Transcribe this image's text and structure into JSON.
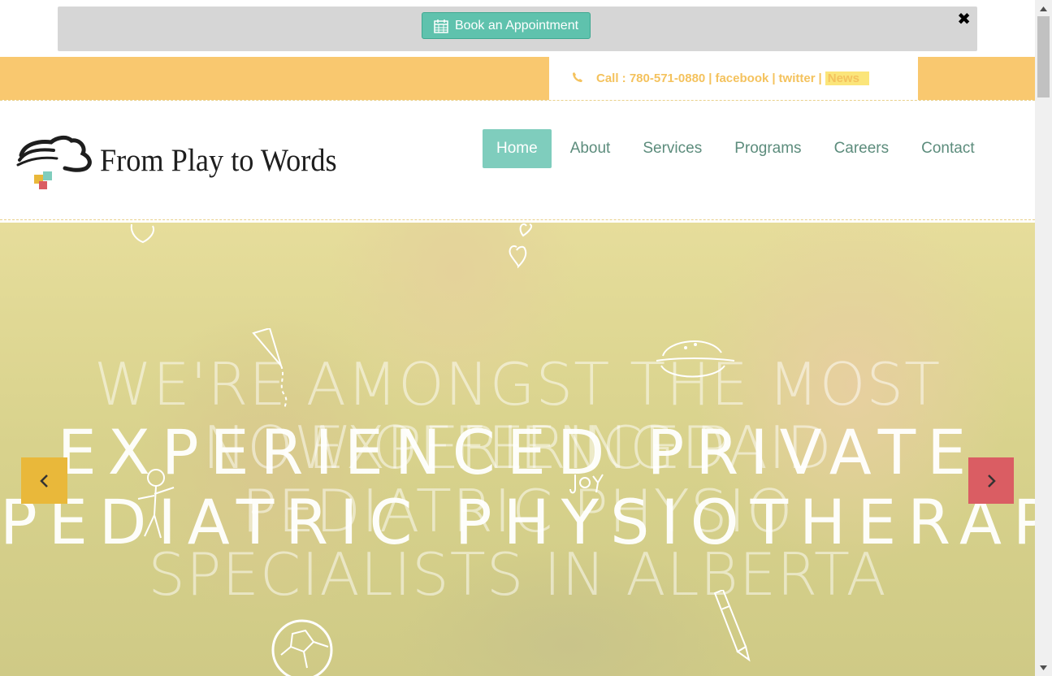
{
  "booking": {
    "button_label": "Book an Appointment",
    "close_symbol": "✖"
  },
  "contact": {
    "call": "Call : 780-571-0880",
    "sep": "|",
    "facebook": "facebook",
    "twitter": "twitter",
    "news": "News"
  },
  "logo": {
    "text": "From Play to Words"
  },
  "nav": {
    "items": [
      {
        "label": "Home",
        "active": true
      },
      {
        "label": "About"
      },
      {
        "label": "Services"
      },
      {
        "label": "Programs"
      },
      {
        "label": "Careers"
      },
      {
        "label": "Contact"
      }
    ]
  },
  "hero": {
    "faded_lines": [
      "WE'RE AMONGST THE MOST",
      "NOW OFFERING PAID",
      "EXPERIENCED",
      "PEDIATRIC PHYSIO",
      "SPECIALISTS IN ALBERTA"
    ],
    "main_lines": [
      "EXPERIENCED PRIVATE",
      "PEDIATRIC PHYSIOTHERAPY"
    ],
    "prev_icon": "chevron-left-icon",
    "next_icon": "chevron-right-icon"
  },
  "colors": {
    "accent_teal": "#7fcdbd",
    "book_button": "#5fc2ad",
    "topbar_yellow": "#f9c86f",
    "contact_text": "#f4c25d",
    "prev_arrow": "#e9b83a",
    "next_arrow": "#da5d63"
  }
}
